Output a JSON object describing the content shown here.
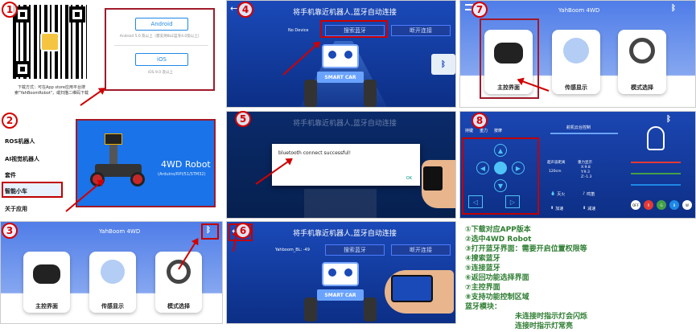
{
  "panel1": {
    "android_label": "Android",
    "android_desc": "Android 5.0 及以上（需支持BLE蓝牙4.0及以上）",
    "ios_label": "iOS",
    "ios_desc": "iOS 9.0 及以上",
    "download_text": "下载方式：可在App store应用平台搜索\"YahBoomRobot\"，或扫描二维码下载"
  },
  "panel2": {
    "menu": [
      "ROS机器人",
      "AI视觉机器人",
      "套件",
      "智能小车",
      "关于应用"
    ],
    "product_title": "4WD Robot",
    "product_sub": "(Arduino/RPI/51/STM32)"
  },
  "panel3": {
    "title": "YahBoom 4WD",
    "cards": [
      "主控界面",
      "传感显示",
      "模式选择"
    ]
  },
  "panel4": {
    "header": "将手机靠近机器人,蓝牙自动连接",
    "device_label": "No Device",
    "btn1": "搜索蓝牙",
    "btn2": "断开连接",
    "smart_car": "SMART CAR"
  },
  "panel5": {
    "header": "将手机靠近机器人,蓝牙自动连接",
    "dialog_text": "bluetooth connect successful!",
    "ok": "OK"
  },
  "panel6": {
    "header": "将手机靠近机器人,蓝牙自动连接",
    "device_label": "Yahboom_BL: -49",
    "btn1": "搜索蓝牙",
    "btn2": "断开连接",
    "smart_car": "SMART CAR"
  },
  "panel7": {
    "title": "YahBoom 4WD",
    "cards": [
      "主控界面",
      "传感显示",
      "模式选择"
    ]
  },
  "panel8": {
    "modes": [
      "持键",
      "重力",
      "按摩"
    ],
    "servo_title": "舵机云台控制",
    "ultrasonic_label": "超声波距离",
    "ultrasonic_value": "120cm",
    "gravity_label": "重力显示",
    "x": "X:9.8",
    "y": "Y:9.3",
    "z": "Z:-1.3",
    "buttons": [
      "灭火",
      "鸣笛",
      "加速",
      "减速"
    ],
    "color_buttons": [
      "OFF",
      "R",
      "G",
      "B",
      "W"
    ]
  },
  "numbers": [
    "1",
    "2",
    "3",
    "4",
    "5",
    "6",
    "7",
    "8"
  ],
  "steps": [
    "①下载对应APP版本",
    "②选中4WD Robot",
    "③打开蓝牙界面：需要开启位置权限等",
    "④搜索蓝牙",
    "⑤连接蓝牙",
    "⑥返回功能选择界面",
    "⑦主控界面",
    "⑧支持功能控制区域",
    "蓝牙模块："
  ],
  "bt_notes": [
    "未连接时指示灯会闪烁",
    "连接时指示灯常亮"
  ]
}
